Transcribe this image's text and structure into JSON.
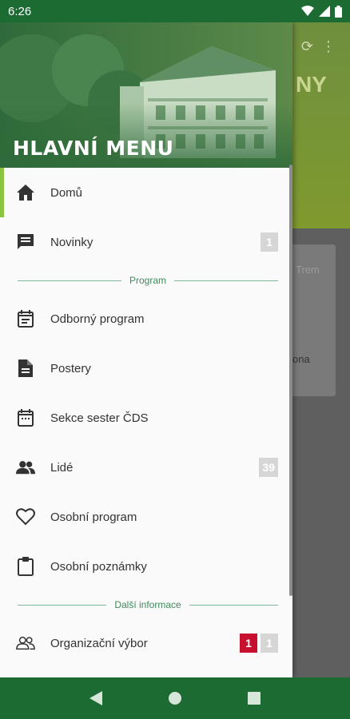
{
  "status_bar": {
    "time": "6:26"
  },
  "background_app": {
    "title_fragment": "NY",
    "card_text_1": "Trem",
    "card_text_2": "ona"
  },
  "drawer": {
    "title": "HLAVNÍ MENU",
    "items_top": [
      {
        "label": "Domů",
        "icon": "home-icon",
        "active": true
      },
      {
        "label": "Novinky",
        "icon": "message-icon",
        "badge": "1"
      }
    ],
    "section_program": "Program",
    "items_program": [
      {
        "label": "Odborný program",
        "icon": "calendar-list-icon"
      },
      {
        "label": "Postery",
        "icon": "document-icon"
      },
      {
        "label": "Sekce sester ČDS",
        "icon": "calendar-icon"
      },
      {
        "label": "Lidé",
        "icon": "people-icon",
        "badge": "39"
      },
      {
        "label": "Osobní program",
        "icon": "heart-icon"
      },
      {
        "label": "Osobní poznámky",
        "icon": "clipboard-icon"
      }
    ],
    "section_more": "Další informace",
    "items_more": [
      {
        "label": "Organizační výbor",
        "icon": "people-outline-icon",
        "badge_red": "1",
        "badge": "1"
      }
    ]
  },
  "colors": {
    "primary": "#1b6b33",
    "accent": "#8bc53f",
    "badge_red": "#c8102e",
    "badge_gray": "#d6d6d6"
  }
}
